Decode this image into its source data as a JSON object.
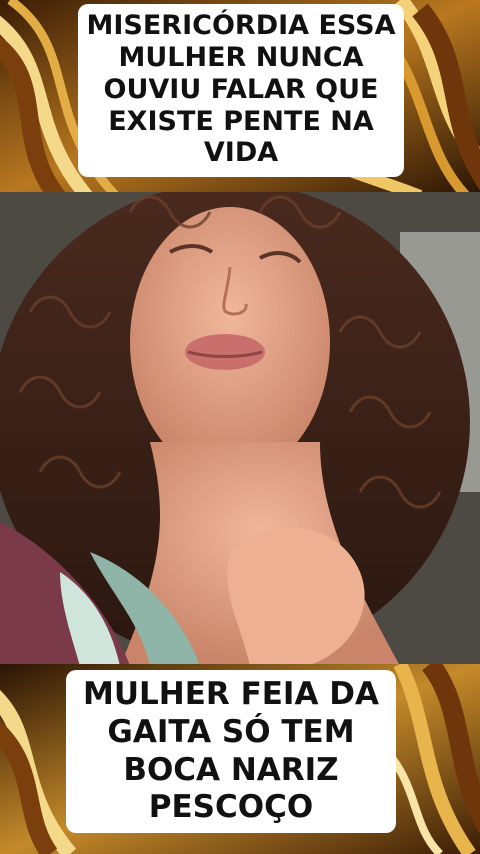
{
  "captions": {
    "top": {
      "lines": [
        "MISERICÓRDIA ESSA",
        "MULHER NUNCA",
        "OUVIU FALAR QUE",
        "EXISTE PENTE NA",
        "VIDA"
      ]
    },
    "bottom": {
      "lines": [
        "MULHER FEIA DA",
        "GAITA SÓ TEM",
        "BOCA NARIZ",
        "PESCOÇO"
      ]
    }
  },
  "colors": {
    "caption_background": "#ffffff",
    "caption_text": "#111111",
    "swirl_dark": "#2a1404",
    "swirl_gold": "#d9a33a",
    "swirl_light": "#f6e2a8"
  }
}
